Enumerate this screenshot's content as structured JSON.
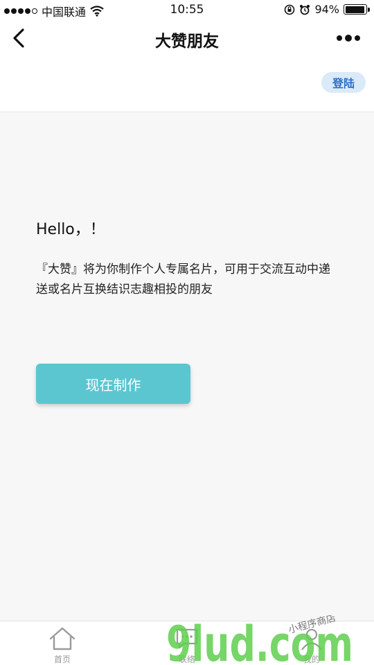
{
  "status_bar": {
    "carrier": "中国联通",
    "time": "10:55",
    "battery": "94%",
    "battery_level": 0.94
  },
  "nav": {
    "title": "大赞朋友",
    "back_icon": "chevron-left-icon",
    "more_icon": "more-dots-icon"
  },
  "header": {
    "login_label": "登陆"
  },
  "main": {
    "greeting": "Hello，！",
    "intro": "『大赞』将为你制作个人专属名片，可用于交流互动中递送或名片互换结识志趣相投的朋友",
    "make_button_label": "现在制作"
  },
  "tab_bar": {
    "tabs": [
      {
        "label": "首页",
        "icon": "home-icon"
      },
      {
        "label": "联络",
        "icon": "chat-icon"
      },
      {
        "label": "我的",
        "icon": "person-icon"
      }
    ]
  },
  "watermark": {
    "text": "9lud.com",
    "caption": "小程序商店"
  },
  "colors": {
    "accent": "#5cc6d0",
    "login_bg": "#dbeaf9",
    "login_text": "#2a70c6",
    "watermark_green": "#5fcf4e"
  }
}
